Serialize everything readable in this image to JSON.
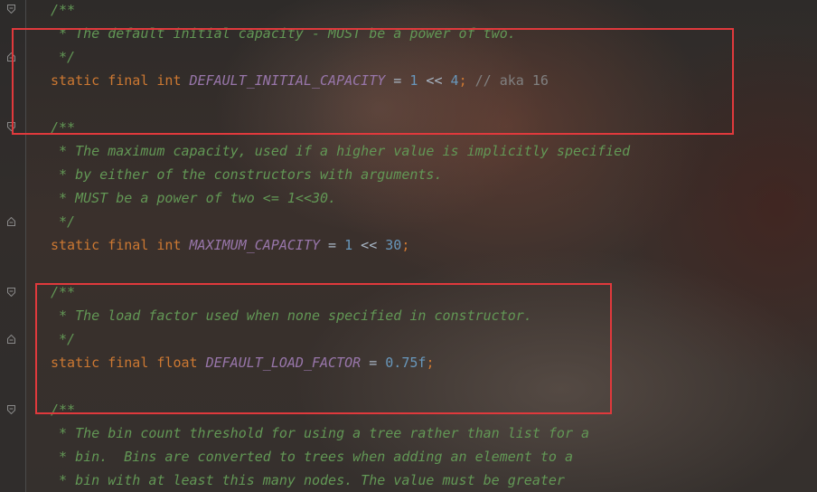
{
  "code": {
    "lines": [
      {
        "id": "l1",
        "parts": [
          {
            "t": "cm",
            "v": "/**"
          }
        ]
      },
      {
        "id": "l2",
        "parts": [
          {
            "t": "cm",
            "v": " * The default initial capacity - MUST be a power of two."
          }
        ]
      },
      {
        "id": "l3",
        "parts": [
          {
            "t": "cm",
            "v": " */"
          }
        ]
      },
      {
        "id": "l4",
        "parts": [
          {
            "t": "kw",
            "v": "static final int "
          },
          {
            "t": "const",
            "v": "DEFAULT_INITIAL_CAPACITY"
          },
          {
            "t": "op",
            "v": " = "
          },
          {
            "t": "num",
            "v": "1"
          },
          {
            "t": "op",
            "v": " << "
          },
          {
            "t": "num",
            "v": "4"
          },
          {
            "t": "sc",
            "v": ";"
          },
          {
            "t": "lc",
            "v": " // aka 16"
          }
        ]
      },
      {
        "id": "l5",
        "parts": []
      },
      {
        "id": "l6",
        "parts": [
          {
            "t": "cm",
            "v": "/**"
          }
        ]
      },
      {
        "id": "l7",
        "parts": [
          {
            "t": "cm",
            "v": " * The maximum capacity, used if a higher value is implicitly specified"
          }
        ]
      },
      {
        "id": "l8",
        "parts": [
          {
            "t": "cm",
            "v": " * by either of the constructors with arguments."
          }
        ]
      },
      {
        "id": "l9",
        "parts": [
          {
            "t": "cm",
            "v": " * MUST be a power of two <= 1<<30."
          }
        ]
      },
      {
        "id": "l10",
        "parts": [
          {
            "t": "cm",
            "v": " */"
          }
        ]
      },
      {
        "id": "l11",
        "parts": [
          {
            "t": "kw",
            "v": "static final int "
          },
          {
            "t": "const",
            "v": "MAXIMUM_CAPACITY"
          },
          {
            "t": "op",
            "v": " = "
          },
          {
            "t": "num",
            "v": "1"
          },
          {
            "t": "op",
            "v": " << "
          },
          {
            "t": "num",
            "v": "30"
          },
          {
            "t": "sc",
            "v": ";"
          }
        ]
      },
      {
        "id": "l12",
        "parts": []
      },
      {
        "id": "l13",
        "parts": [
          {
            "t": "cm",
            "v": "/**"
          }
        ]
      },
      {
        "id": "l14",
        "parts": [
          {
            "t": "cm",
            "v": " * The load factor used when none specified in constructor."
          }
        ]
      },
      {
        "id": "l15",
        "parts": [
          {
            "t": "cm",
            "v": " */"
          }
        ]
      },
      {
        "id": "l16",
        "parts": [
          {
            "t": "kw",
            "v": "static final float "
          },
          {
            "t": "const",
            "v": "DEFAULT_LOAD_FACTOR"
          },
          {
            "t": "op",
            "v": " = "
          },
          {
            "t": "num",
            "v": "0.75f"
          },
          {
            "t": "sc",
            "v": ";"
          }
        ]
      },
      {
        "id": "l17",
        "parts": []
      },
      {
        "id": "l18",
        "parts": [
          {
            "t": "cm",
            "v": "/**"
          }
        ]
      },
      {
        "id": "l19",
        "parts": [
          {
            "t": "cm",
            "v": " * The bin count threshold for using a tree rather than list for a"
          }
        ]
      },
      {
        "id": "l20",
        "parts": [
          {
            "t": "cm",
            "v": " * bin.  Bins are converted to trees when adding an element to a"
          }
        ]
      },
      {
        "id": "l21",
        "parts": [
          {
            "t": "cm",
            "v": " * bin with at least this many nodes. The value must be greater"
          }
        ]
      }
    ]
  },
  "colors": {
    "keyword": "#cc7832",
    "constant": "#9876aa",
    "number": "#6897bb",
    "comment": "#629755",
    "line_comment": "#808080",
    "highlight_box": "#e0393c"
  }
}
